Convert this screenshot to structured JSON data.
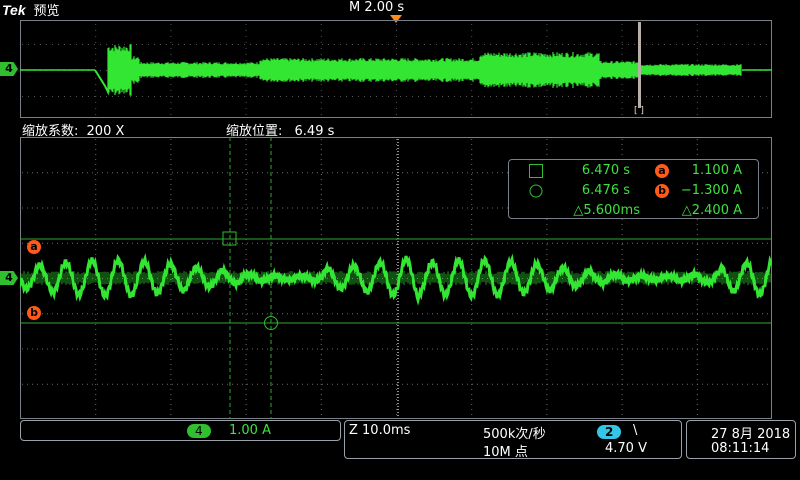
{
  "header": {
    "brand": "Tek",
    "mode": "预览",
    "timebase": "M 2.00 s"
  },
  "overview": {
    "channel_marker": "4",
    "zoom_box_label": "[ ]"
  },
  "zoom_info": {
    "factor_label": "缩放系数:",
    "factor_value": "200 X",
    "position_label": "缩放位置:",
    "position_value": "6.49 s"
  },
  "cursor_readout": {
    "row1": {
      "icon": "square-cursor-icon",
      "time": "6.470 s",
      "badge": "a",
      "value": "1.100 A"
    },
    "row2": {
      "icon": "circle-cursor-icon",
      "time": "6.476 s",
      "badge": "b",
      "value": "−1.300 A"
    },
    "delta_time": "△5.600ms",
    "delta_value": "△2.400 A"
  },
  "main_plot": {
    "channel_marker": "4",
    "cursor_a_label": "a",
    "cursor_b_label": "b"
  },
  "status": {
    "channel_badge": "4",
    "channel_scale": "1.00 A",
    "zoom_time": "Z 10.0ms",
    "sample_rate": "500k次/秒",
    "record_length": "10M 点",
    "trigger_channel": "2",
    "trigger_slope": "\\",
    "trigger_level": "4.70 V",
    "date": "27 8月 2018",
    "time": "08:11:14"
  },
  "colors": {
    "waveform": "#33e633",
    "cursor": "#ff5a1a",
    "trigger": "#33c6e6",
    "grid": "#3a4048"
  }
}
